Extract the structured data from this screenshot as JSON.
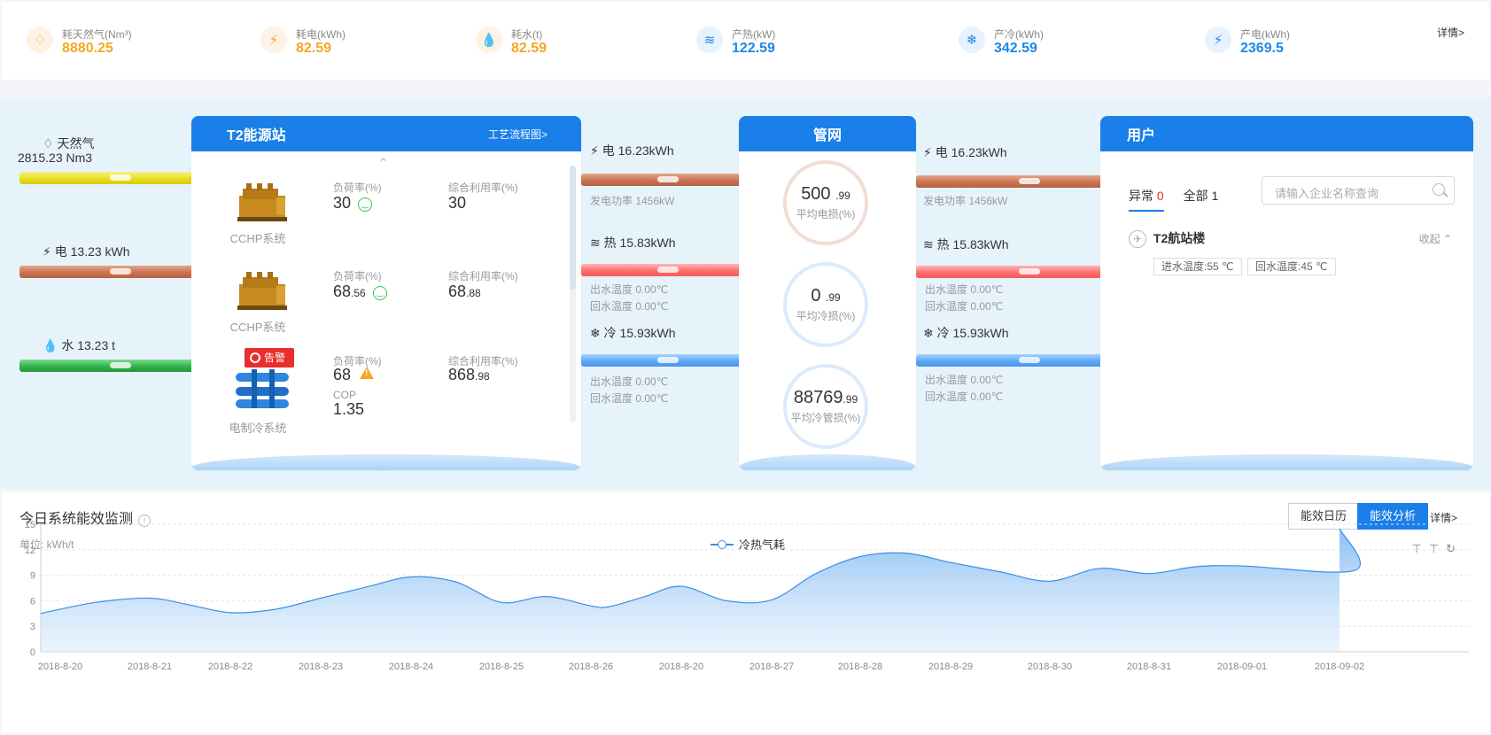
{
  "top_stats": [
    {
      "label": "耗天然气(Nm³)",
      "value": "8880.25",
      "icon": "flame-icon",
      "color": "orange"
    },
    {
      "label": "耗电(kWh)",
      "value": "82.59",
      "icon": "lightning-icon",
      "color": "orange"
    },
    {
      "label": "耗水(t)",
      "value": "82.59",
      "icon": "water-drop-icon",
      "color": "orange"
    },
    {
      "label": "产热(kW)",
      "value": "122.59",
      "icon": "heat-icon",
      "color": "blue"
    },
    {
      "label": "产冷(kWh)",
      "value": "342.59",
      "icon": "snowflake-icon",
      "color": "blue"
    },
    {
      "label": "产电(kWh)",
      "value": "2369.5",
      "icon": "lightning-icon",
      "color": "blue"
    }
  ],
  "top_detail": "详情>",
  "sources": {
    "gas_name": "天然气",
    "gas_value": "2815.23 Nm3",
    "elec": "电 13.23 kWh",
    "water": "水 13.23 t"
  },
  "station": {
    "title": "T2能源站",
    "link": "工艺流程图>",
    "systems": [
      {
        "name": "CCHP系统",
        "load_label": "负荷率(%)",
        "load": "30",
        "load_small": "",
        "util_label": "综合利用率(%)",
        "util": "30",
        "util_small": ""
      },
      {
        "name": "CCHP系统",
        "load_label": "负荷率(%)",
        "load": "68",
        "load_small": ".56",
        "util_label": "综合利用率(%)",
        "util": "68",
        "util_small": ".88"
      },
      {
        "name": "电制冷系统",
        "load_label": "负荷率(%)",
        "load": "68",
        "load_small": "",
        "util_label": "综合利用率(%)",
        "util": "868",
        "util_small": ".98",
        "alarm": "告警",
        "cop_label": "COP",
        "cop": "1.35"
      }
    ]
  },
  "mid_left": {
    "elec": "电 16.23kWh",
    "elec_sub": "发电功率 1456kW",
    "heat": "热 15.83kWh",
    "heat_out": "出水温度 0.00℃",
    "heat_back": "回水温度 0.00℃",
    "cold": "冷 15.93kWh",
    "cold_out": "出水温度 0.00℃",
    "cold_back": "回水温度 0.00℃"
  },
  "network": {
    "title": "管网",
    "rings": [
      {
        "n": "500",
        "s": ".99",
        "t": "平均电损(%)"
      },
      {
        "n": "0",
        "s": ".99",
        "t": "平均冷损(%)"
      },
      {
        "n": "88769",
        "s": ".99",
        "t": "平均冷管损(%)"
      }
    ]
  },
  "mid_right": {
    "elec": "电 16.23kWh",
    "elec_sub": "发电功率 1456kW",
    "heat": "热 15.83kWh",
    "heat_out": "出水温度 0.00℃",
    "heat_back": "回水温度 0.00℃",
    "cold": "冷 15.93kWh",
    "cold_out": "出水温度 0.00℃",
    "cold_back": "回水温度 0.00℃"
  },
  "user": {
    "title": "用户",
    "tab_abnormal": "异常",
    "abnormal_count": "0",
    "tab_all": "全部",
    "all_count": "1",
    "search_placeholder": "请输入企业名称查询",
    "item": "T2航站楼",
    "collapse": "收起",
    "tag_in": "进水温度:55 ℃",
    "tag_back": "回水温度:45 ℃"
  },
  "monitor": {
    "title": "今日系统能效监测",
    "unit": "单位: kWh/t",
    "btn_calendar": "能效日历",
    "btn_analysis": "能效分析",
    "detail": "详情>",
    "legend": "冷热气耗"
  },
  "chart_data": {
    "type": "area",
    "title": "",
    "xlabel": "",
    "ylabel": "",
    "ylim": [
      0,
      15
    ],
    "yticks": [
      0,
      3,
      6,
      9,
      12,
      15
    ],
    "grid": true,
    "legend_position": "top-center",
    "categories": [
      "2018-8-20",
      "2018-8-21",
      "2018-8-22",
      "2018-8-23",
      "2018-8-24",
      "2018-8-25",
      "2018-8-26",
      "2018-8-20",
      "2018-8-27",
      "2018-8-28",
      "2018-8-29",
      "2018-8-30",
      "2018-8-31",
      "2018-09-01",
      "2018-09-02"
    ],
    "series": [
      {
        "name": "冷热气耗",
        "x": [
          0,
          0.5,
          1,
          1.5,
          2,
          2.5,
          3,
          3.5,
          4,
          4.5,
          5,
          5.5,
          6,
          6.2,
          6.6,
          7,
          7.5,
          8,
          8.5,
          9,
          9.5,
          10,
          10.5,
          11,
          11.5,
          12,
          12.5,
          13,
          13.5,
          14
        ],
        "values": [
          4.5,
          5.8,
          6.3,
          5.5,
          4.6,
          5.0,
          6.3,
          7.6,
          8.8,
          8.2,
          5.8,
          6.5,
          5.4,
          5.3,
          6.5,
          7.7,
          6.0,
          6.1,
          9.2,
          11.2,
          11.6,
          10.5,
          9.4,
          8.3,
          9.8,
          9.2,
          10.0,
          10.1,
          9.6,
          14.5
        ]
      }
    ]
  },
  "colors": {
    "accent": "#1a7fe8",
    "orange": "#f5a623",
    "flow_bg": "#e6f3fb"
  }
}
